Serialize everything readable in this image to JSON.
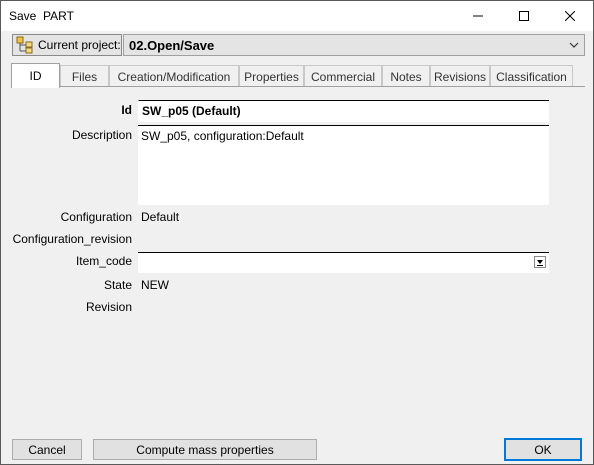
{
  "window": {
    "title": "Save  PART"
  },
  "project": {
    "button_label": "Current project:",
    "value": "02.Open/Save"
  },
  "tabs": [
    "ID",
    "Files",
    "Creation/Modification",
    "Properties",
    "Commercial",
    "Notes",
    "Revisions",
    "Classification"
  ],
  "form": {
    "id_label": "Id",
    "id_value": "SW_p05 (Default)",
    "description_label": "Description",
    "description_value": "SW_p05, configuration:Default",
    "configuration_label": "Configuration",
    "configuration_value": "Default",
    "configuration_revision_label": "Configuration_revision",
    "item_code_label": "Item_code",
    "item_code_value": "",
    "state_label": "State",
    "state_value": "NEW",
    "revision_label": "Revision"
  },
  "buttons": {
    "cancel": "Cancel",
    "compute": "Compute mass properties",
    "ok": "OK"
  },
  "colors": {
    "ok_border": "#0078d7",
    "active_tab": "#ffffff"
  }
}
